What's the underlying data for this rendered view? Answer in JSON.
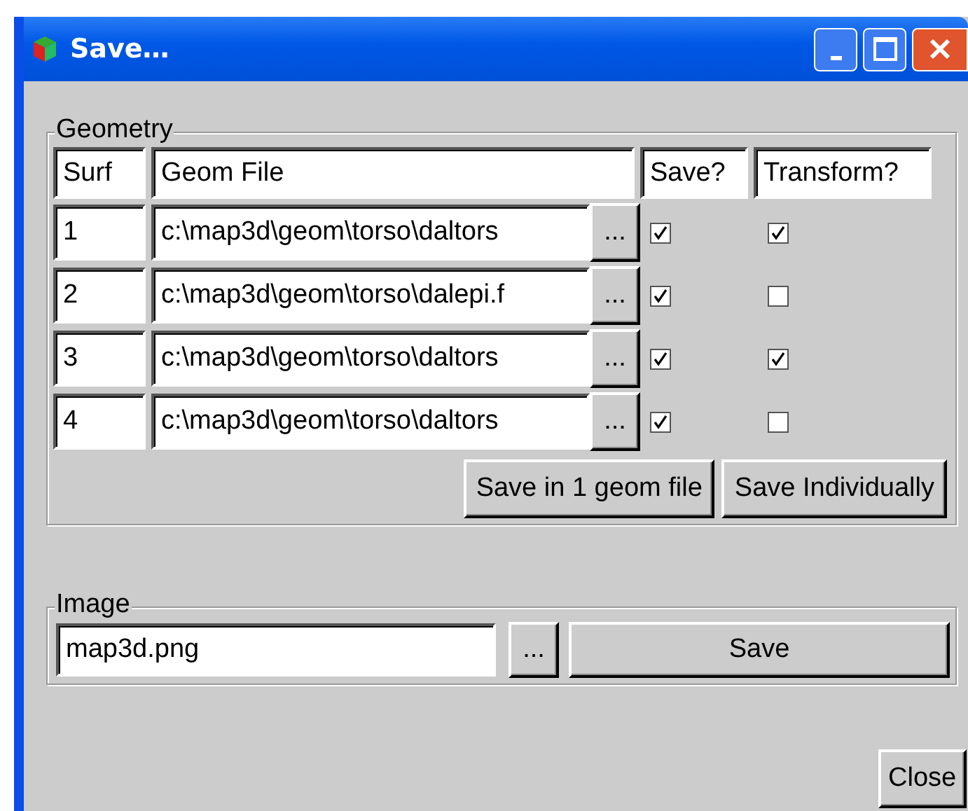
{
  "window": {
    "title": "Save…"
  },
  "geometry": {
    "legend": "Geometry",
    "columns": [
      "Surf",
      "Geom File",
      "Save?",
      "Transform?"
    ],
    "rows": [
      {
        "surf": "1",
        "file": "c:\\map3d\\geom\\torso\\daltors",
        "browse": "...",
        "save": true,
        "transform": true
      },
      {
        "surf": "2",
        "file": "c:\\map3d\\geom\\torso\\dalepi.f",
        "browse": "...",
        "save": true,
        "transform": false
      },
      {
        "surf": "3",
        "file": "c:\\map3d\\geom\\torso\\daltors",
        "browse": "...",
        "save": true,
        "transform": true
      },
      {
        "surf": "4",
        "file": "c:\\map3d\\geom\\torso\\daltors",
        "browse": "...",
        "save": true,
        "transform": false
      }
    ],
    "buttons": [
      "Save in 1 geom file",
      "Save Individually"
    ]
  },
  "image": {
    "legend": "Image",
    "file": "map3d.png",
    "browse": "...",
    "save": "Save"
  },
  "close": "Close"
}
